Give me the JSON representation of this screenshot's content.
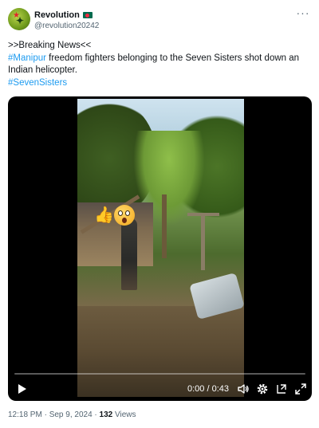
{
  "author": {
    "display_name": "Revolution",
    "handle": "@revolution20242",
    "flag_icon": "bangladesh-flag-icon"
  },
  "tweet": {
    "line1": ">>Breaking News<<",
    "hashtag1": "#Manipur",
    "line2_rest": " freedom fighters belonging to the Seven Sisters shot down an Indian helicopter.",
    "hashtag2": "#SevenSisters"
  },
  "video": {
    "timecode": "0:00 / 0:43",
    "progress": 0,
    "overlay_emojis": [
      "thumbs-up-emoji",
      "astonished-face-emoji"
    ],
    "controls": [
      "play-icon",
      "volume-icon",
      "settings-gear-icon",
      "pip-icon",
      "fullscreen-icon"
    ]
  },
  "meta": {
    "time": "12:18 PM",
    "separator": " · ",
    "date": "Sep 9, 2024",
    "views_count": "132",
    "views_label": " Views"
  },
  "colors": {
    "link": "#1d9bf0",
    "secondary_text": "#536471",
    "primary_text": "#0f1419"
  }
}
